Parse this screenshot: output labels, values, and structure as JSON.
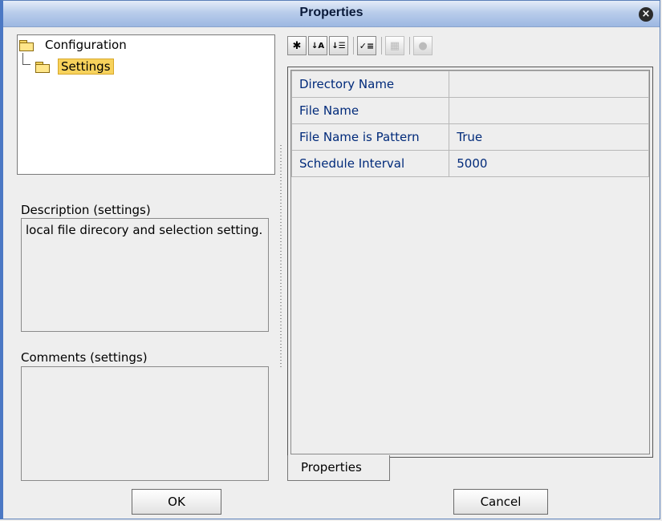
{
  "window": {
    "title": "Properties",
    "close_icon": "close-icon"
  },
  "tree": {
    "root_label": "Configuration",
    "child_label": "Settings"
  },
  "description": {
    "label": "Description (settings)",
    "text": "local file direcory and selection setting."
  },
  "comments": {
    "label": "Comments (settings)",
    "text": ""
  },
  "toolbar": {
    "buttons": [
      "expand-icon",
      "sort-az-icon",
      "sort-category-icon",
      "filter-list-icon",
      "grid-icon",
      "help-icon"
    ]
  },
  "properties": {
    "rows": [
      {
        "name": "Directory Name",
        "value": ""
      },
      {
        "name": "File Name",
        "value": ""
      },
      {
        "name": "File Name is Pattern",
        "value": "True"
      },
      {
        "name": "Schedule Interval",
        "value": "5000"
      }
    ],
    "tab_label": "Properties"
  },
  "buttons": {
    "ok": "OK",
    "cancel": "Cancel"
  },
  "colors": {
    "selection": "#f7d25c",
    "property_text": "#002a7a",
    "title_bar": "#b9cdeb"
  }
}
